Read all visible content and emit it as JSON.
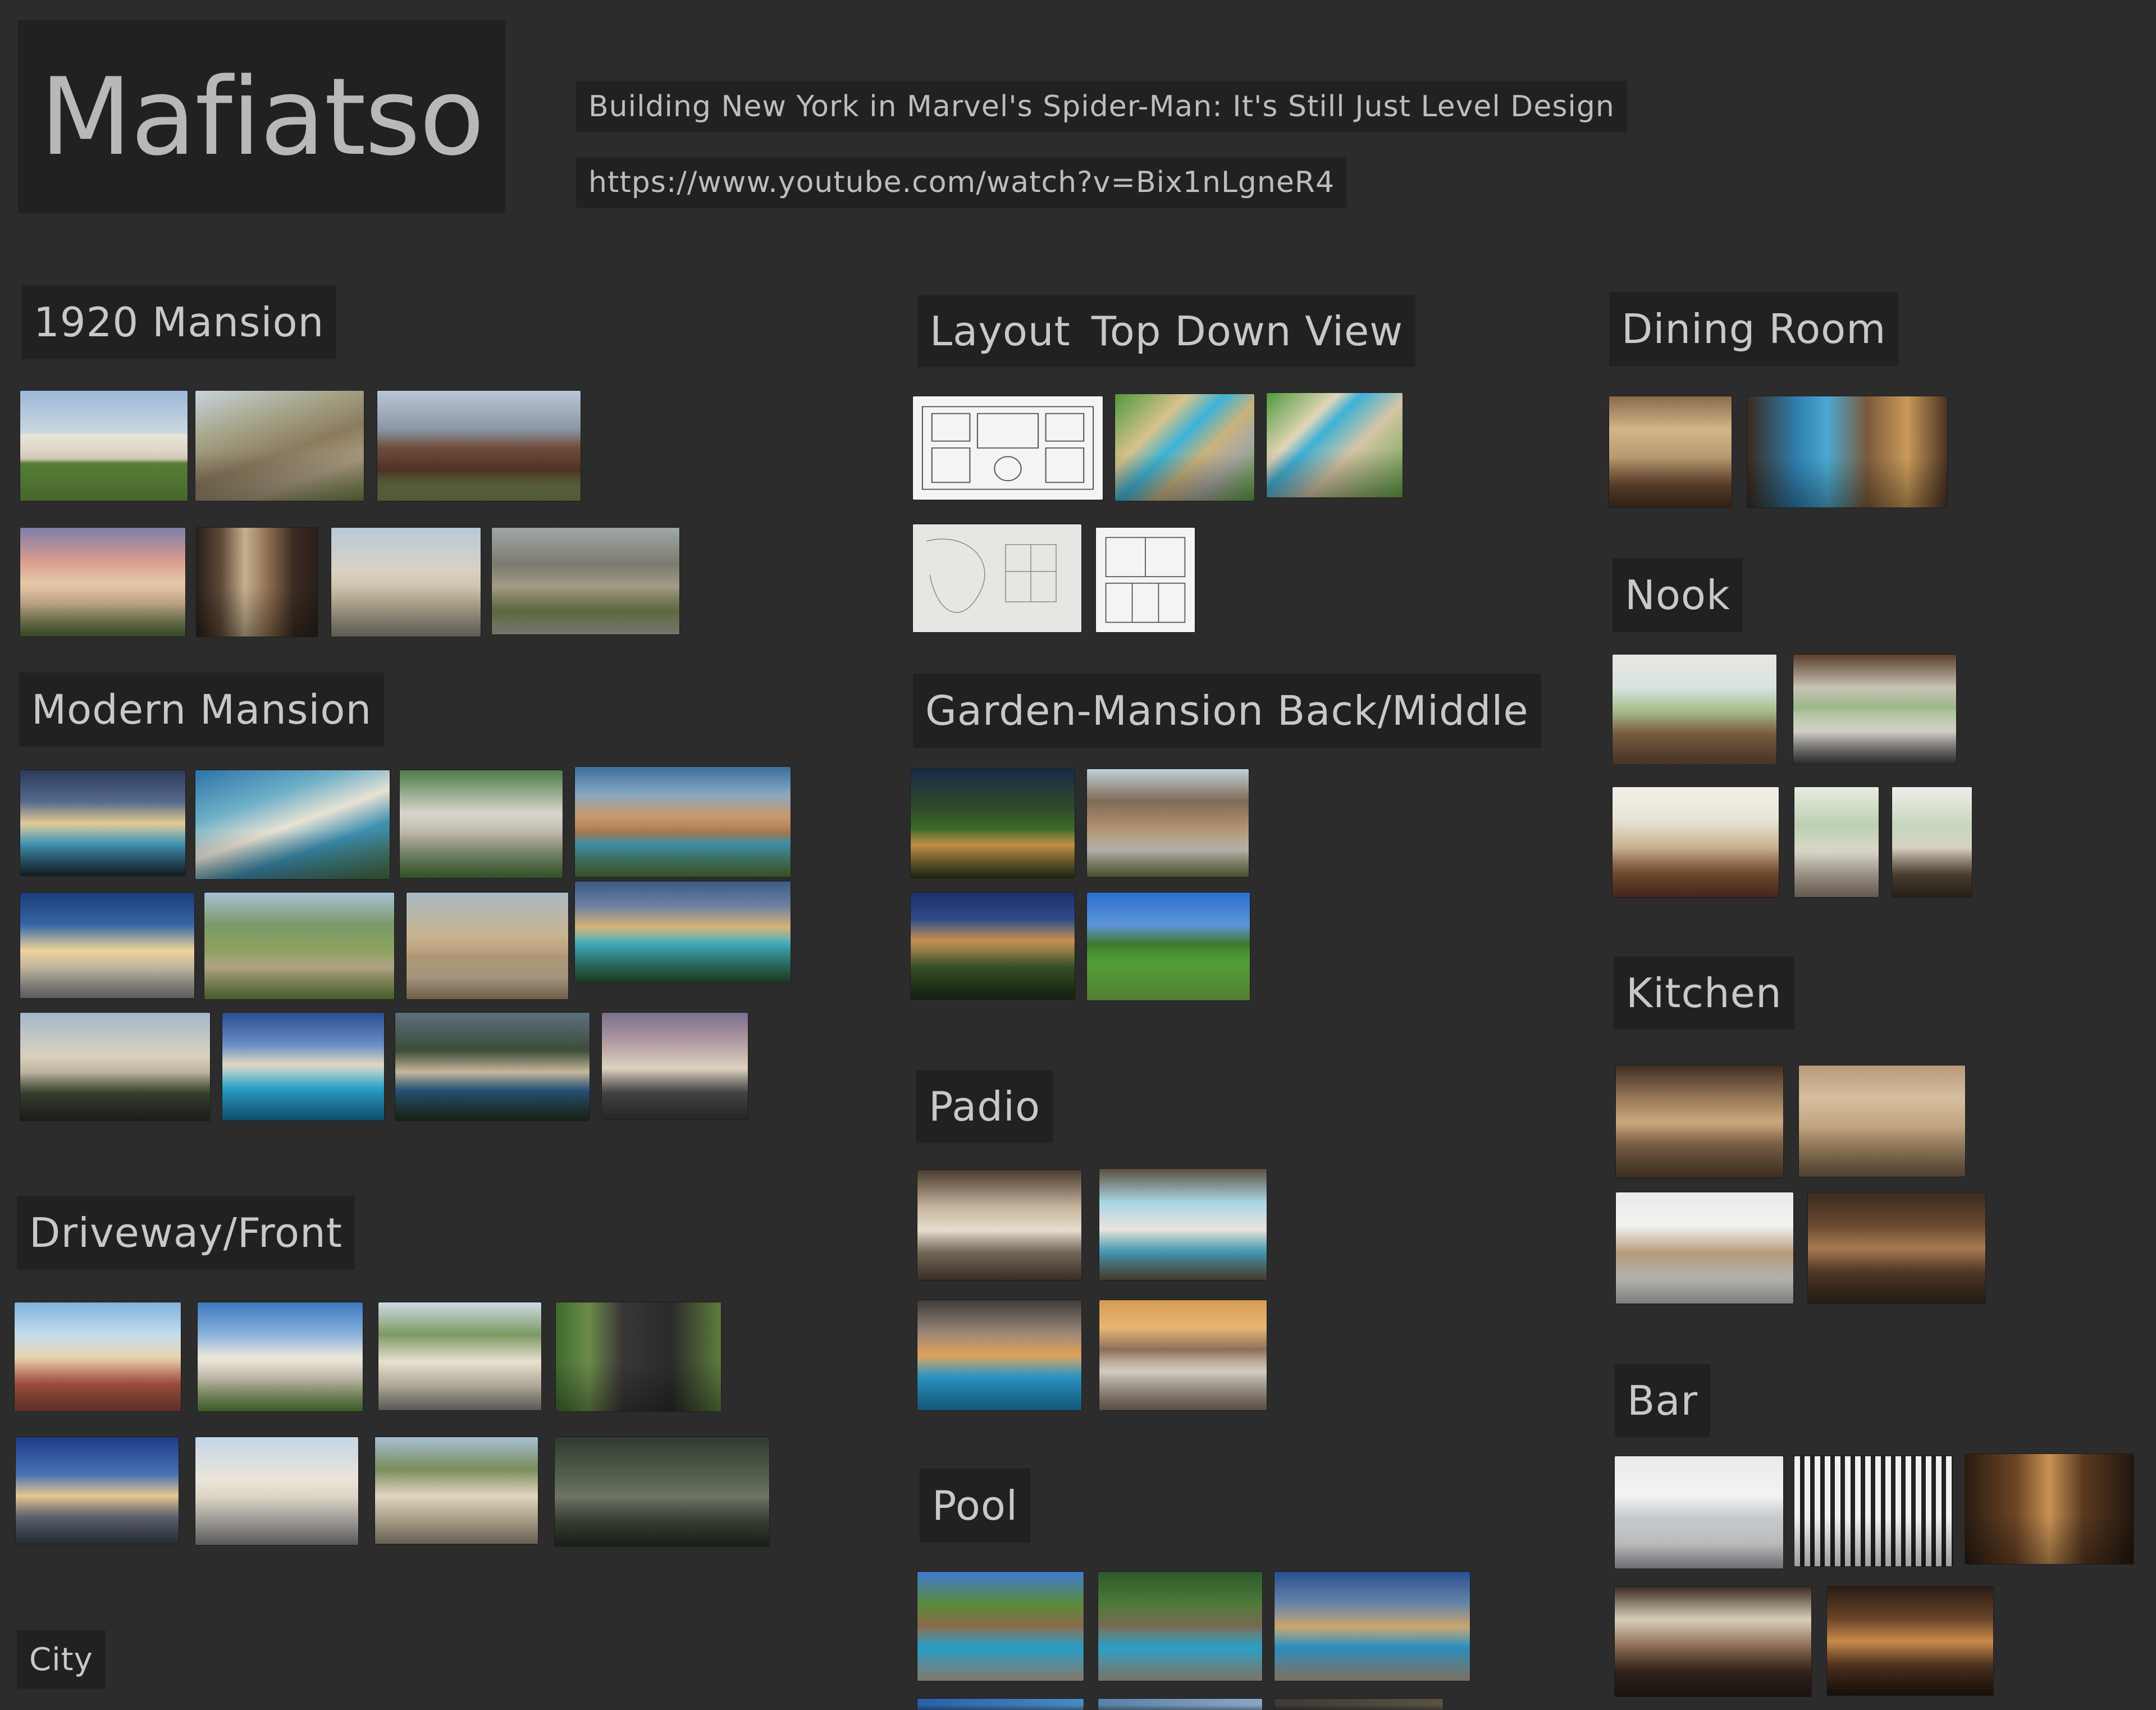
{
  "board": {
    "title": "Mafiatso",
    "notes": {
      "video_title": "Building New York in Marvel's Spider-Man: It's Still Just Level Design",
      "video_url": "https://www.youtube.com/watch?v=Bix1nLgneR4"
    },
    "sections": {
      "mansion_1920": "1920 Mansion",
      "modern_mansion": "Modern Mansion",
      "driveway_front": "Driveway/Front",
      "city": "City",
      "layout": "Layout",
      "top_down_view": "Top Down View",
      "garden_back_middle": "Garden-Mansion Back/Middle",
      "padio": "Padio",
      "pool": "Pool",
      "dining_room": "Dining Room",
      "nook": "Nook",
      "kitchen": "Kitchen",
      "bar": "Bar"
    }
  }
}
